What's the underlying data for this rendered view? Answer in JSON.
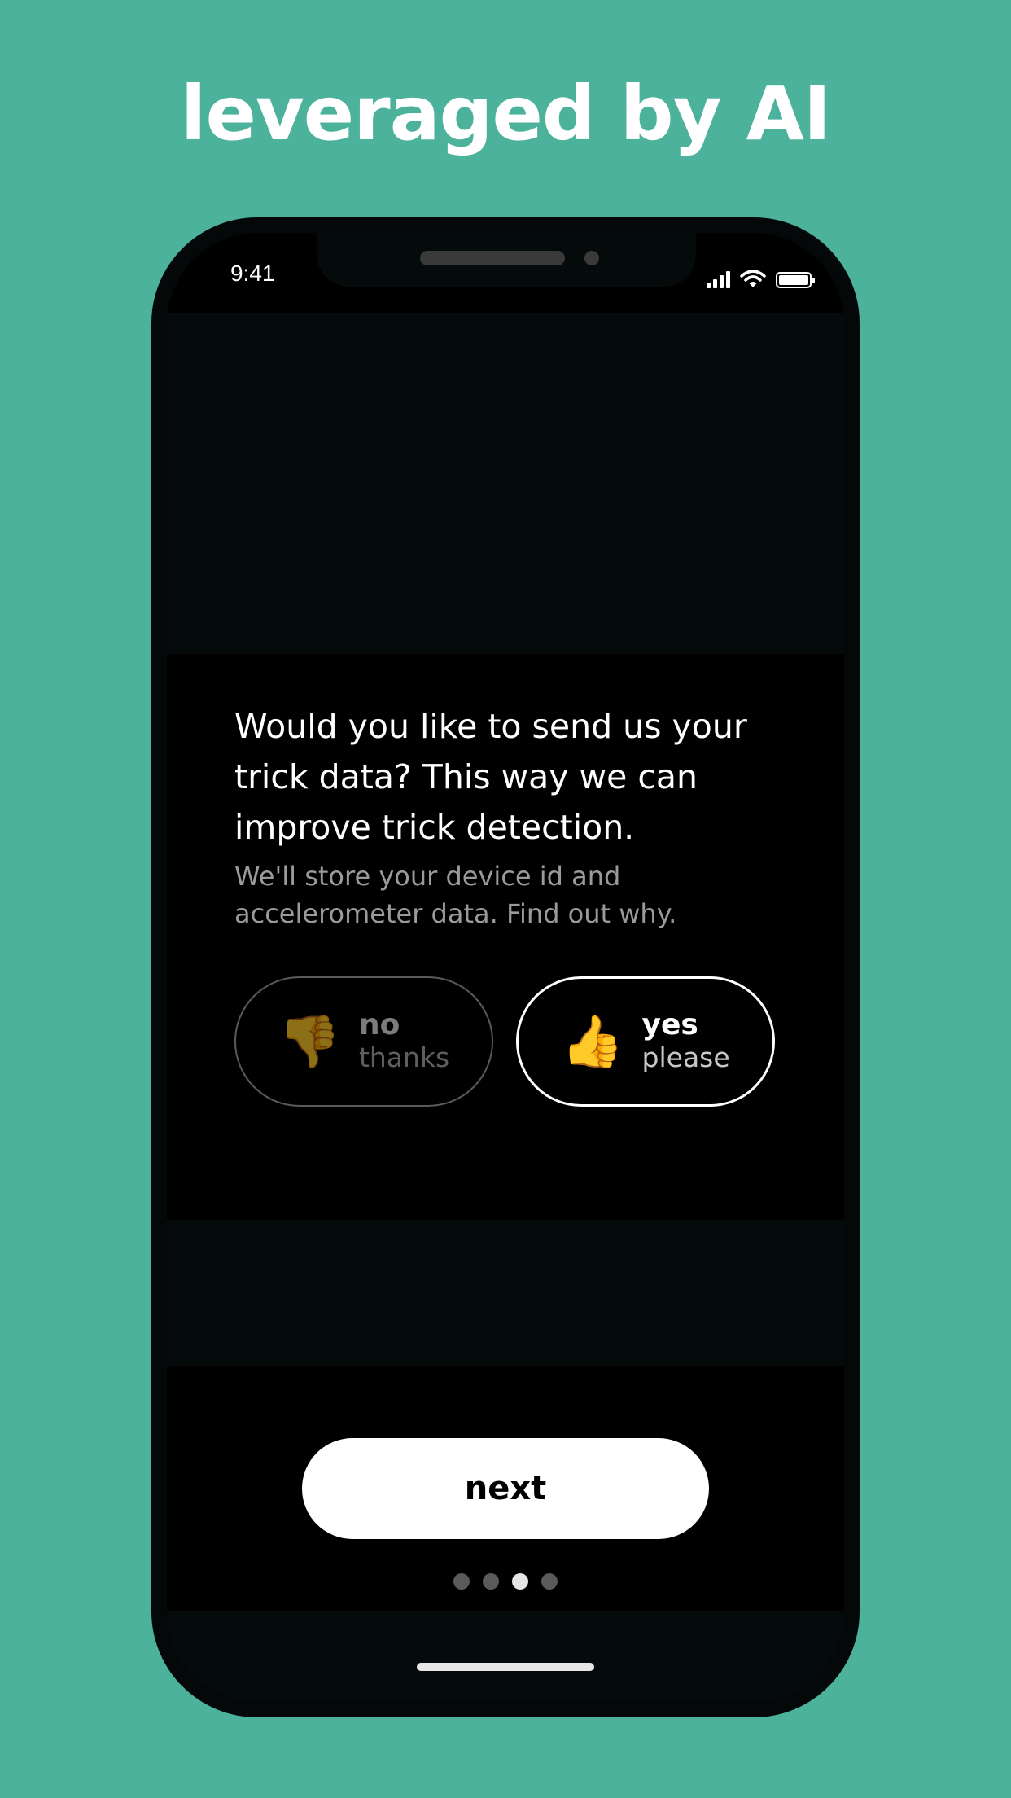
{
  "headline": "leveraged by AI",
  "status_bar": {
    "time": "9:41",
    "icons": [
      "cellular-signal-icon",
      "wifi-icon",
      "battery-icon"
    ]
  },
  "prompt": {
    "question": "Would you like to send us your trick data? This way we can improve trick detection.",
    "subtext": "We'll store your device id and accelerometer data. Find out why."
  },
  "choices": {
    "no": {
      "icon": "thumbs-down-icon",
      "glyph": "👎",
      "label": "no",
      "sublabel": "thanks"
    },
    "yes": {
      "icon": "thumbs-up-icon",
      "glyph": "👍",
      "label": "yes",
      "sublabel": "please"
    }
  },
  "next_button": {
    "label": "next"
  },
  "pagination": {
    "total": 4,
    "current": 3
  },
  "colors": {
    "background": "#4db29c",
    "phone": "#040808",
    "screen": "#000000",
    "button": "#ffffff"
  }
}
